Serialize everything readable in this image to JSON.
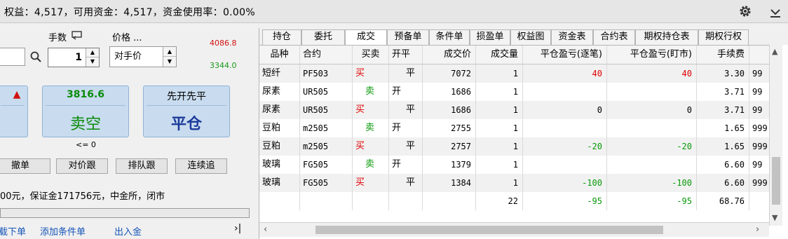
{
  "status_bar": {
    "text": "权益：4,517，可用资金：4,517，资金使用率：0.00%",
    "settings_icon": "gear-icon",
    "collapse_icon": "chevron-down-icon"
  },
  "order_panel": {
    "qty_label": "手数",
    "qty_value": "1",
    "price_label": "价格 ...",
    "price_value": "对手价",
    "upper_price": "4086.8",
    "lower_price": "3344.0",
    "buy_button_arrow": "▲",
    "sell_button": {
      "price": "3816.6",
      "label": "卖空"
    },
    "close_button": {
      "top": "先开先平",
      "label": "平仓"
    },
    "sell_hint": "<= 0",
    "action_buttons": [
      "撤单",
      "对价跟",
      "排队跟",
      "连续追"
    ],
    "info_text": "00元，保证金171756元，中金所，闭市",
    "links": [
      "载下单",
      "添加条件单",
      "出入金"
    ],
    "collapse_glyph": "›|"
  },
  "tabs": [
    "持仓",
    "委托",
    "成交",
    "预备单",
    "条件单",
    "损盈单",
    "权益图",
    "资金表",
    "合约表",
    "期权持仓表",
    "期权行权"
  ],
  "active_tab": "成交",
  "trades_table": {
    "headers": [
      "品种",
      "合约",
      "买卖",
      "开平",
      "成交价",
      "成交量",
      "平仓盈亏(逐笔)",
      "平仓盈亏(盯市)",
      "手续费",
      ""
    ],
    "rows": [
      {
        "variety": "短纤",
        "contract": "PF503",
        "side": "买",
        "offset": "平",
        "price": "7072",
        "qty": "1",
        "pnl_trade": "40",
        "pnl_mark": "40",
        "fee": "3.30",
        "extra": "99"
      },
      {
        "variety": "尿素",
        "contract": "UR505",
        "side": "卖",
        "offset": "开",
        "price": "1686",
        "qty": "1",
        "pnl_trade": "",
        "pnl_mark": "",
        "fee": "3.71",
        "extra": "99"
      },
      {
        "variety": "尿素",
        "contract": "UR505",
        "side": "买",
        "offset": "平",
        "price": "1686",
        "qty": "1",
        "pnl_trade": "0",
        "pnl_mark": "0",
        "fee": "3.71",
        "extra": "99"
      },
      {
        "variety": "豆粕",
        "contract": "m2505",
        "side": "卖",
        "offset": "开",
        "price": "2755",
        "qty": "1",
        "pnl_trade": "",
        "pnl_mark": "",
        "fee": "1.65",
        "extra": "999"
      },
      {
        "variety": "豆粕",
        "contract": "m2505",
        "side": "买",
        "offset": "平",
        "price": "2757",
        "qty": "1",
        "pnl_trade": "-20",
        "pnl_mark": "-20",
        "fee": "1.65",
        "extra": "999"
      },
      {
        "variety": "玻璃",
        "contract": "FG505",
        "side": "卖",
        "offset": "开",
        "price": "1379",
        "qty": "1",
        "pnl_trade": "",
        "pnl_mark": "",
        "fee": "6.60",
        "extra": "99"
      },
      {
        "variety": "玻璃",
        "contract": "FG505",
        "side": "买",
        "offset": "平",
        "price": "1384",
        "qty": "1",
        "pnl_trade": "-100",
        "pnl_mark": "-100",
        "fee": "6.60",
        "extra": "999"
      }
    ],
    "totals": {
      "qty": "22",
      "pnl_trade": "-95",
      "pnl_mark": "-95",
      "fee": "68.76"
    }
  },
  "colors": {
    "buy": "#e00000",
    "sell": "#0a9a0a",
    "accent": "#c9dcef",
    "link": "#1655b8"
  }
}
